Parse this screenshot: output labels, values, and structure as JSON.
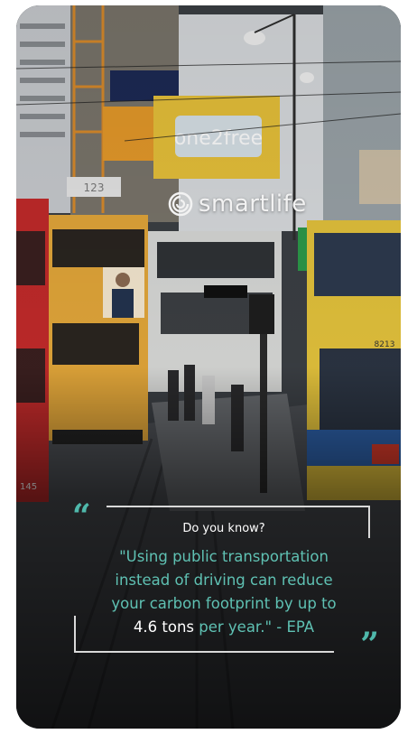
{
  "brand": {
    "name": "smartlife",
    "icon": "swirl-logo-icon"
  },
  "quote": {
    "heading": "Do you know?",
    "line1": "\"Using public transportation",
    "line2": "instead of driving can reduce",
    "line3": "your carbon footprint by up to",
    "highlight": "4.6 tons",
    "line4_after": " per year.\" - EPA",
    "open_mark": "“",
    "close_mark": "”"
  },
  "scene": {
    "billboard_text": "one2free",
    "bus_number": "8213",
    "tram_number": "145",
    "sign_number": "123"
  },
  "colors": {
    "accent": "#5fc1b3",
    "frame": "#d9d9d9"
  }
}
